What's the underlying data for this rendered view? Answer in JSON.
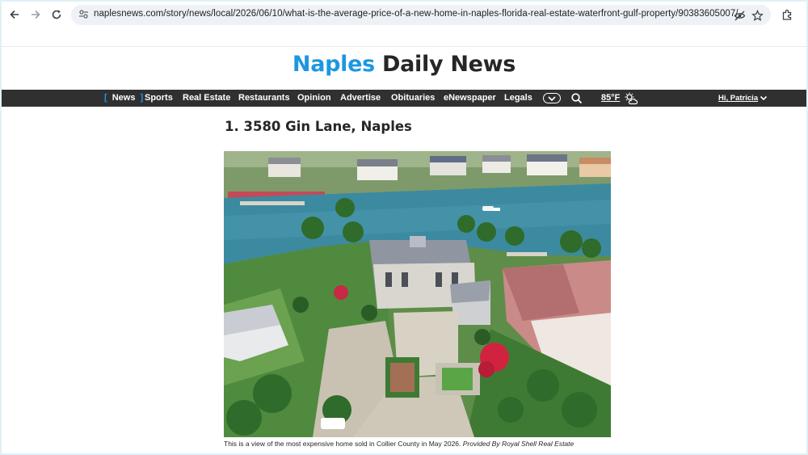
{
  "browser": {
    "url": "naplesnews.com/story/news/local/2026/06/10/what-is-the-average-price-of-a-new-home-in-naples-florida-real-estate-waterfront-gulf-property/90383605007/"
  },
  "site": {
    "brand_first": "Naples",
    "brand_rest": "Daily News"
  },
  "nav": {
    "items": [
      "Sports",
      "Real Estate",
      "Restaurants",
      "Opinion",
      "Advertise",
      "Obituaries",
      "eNewspaper",
      "Legals"
    ],
    "active": "News",
    "bracket_open": "[",
    "bracket_close": "]",
    "weather": "85°F",
    "user": "Hi, Patricia"
  },
  "article": {
    "headline": "1. 3580 Gin Lane, Naples",
    "caption_text": "This is a view of the most expensive home sold in Collier County in May 2026.",
    "caption_credit": "Provided By Royal Shell Real Estate"
  },
  "colors": {
    "brand_blue": "#1e97e1",
    "nav_bg": "#303030",
    "text_dark": "#262626"
  }
}
